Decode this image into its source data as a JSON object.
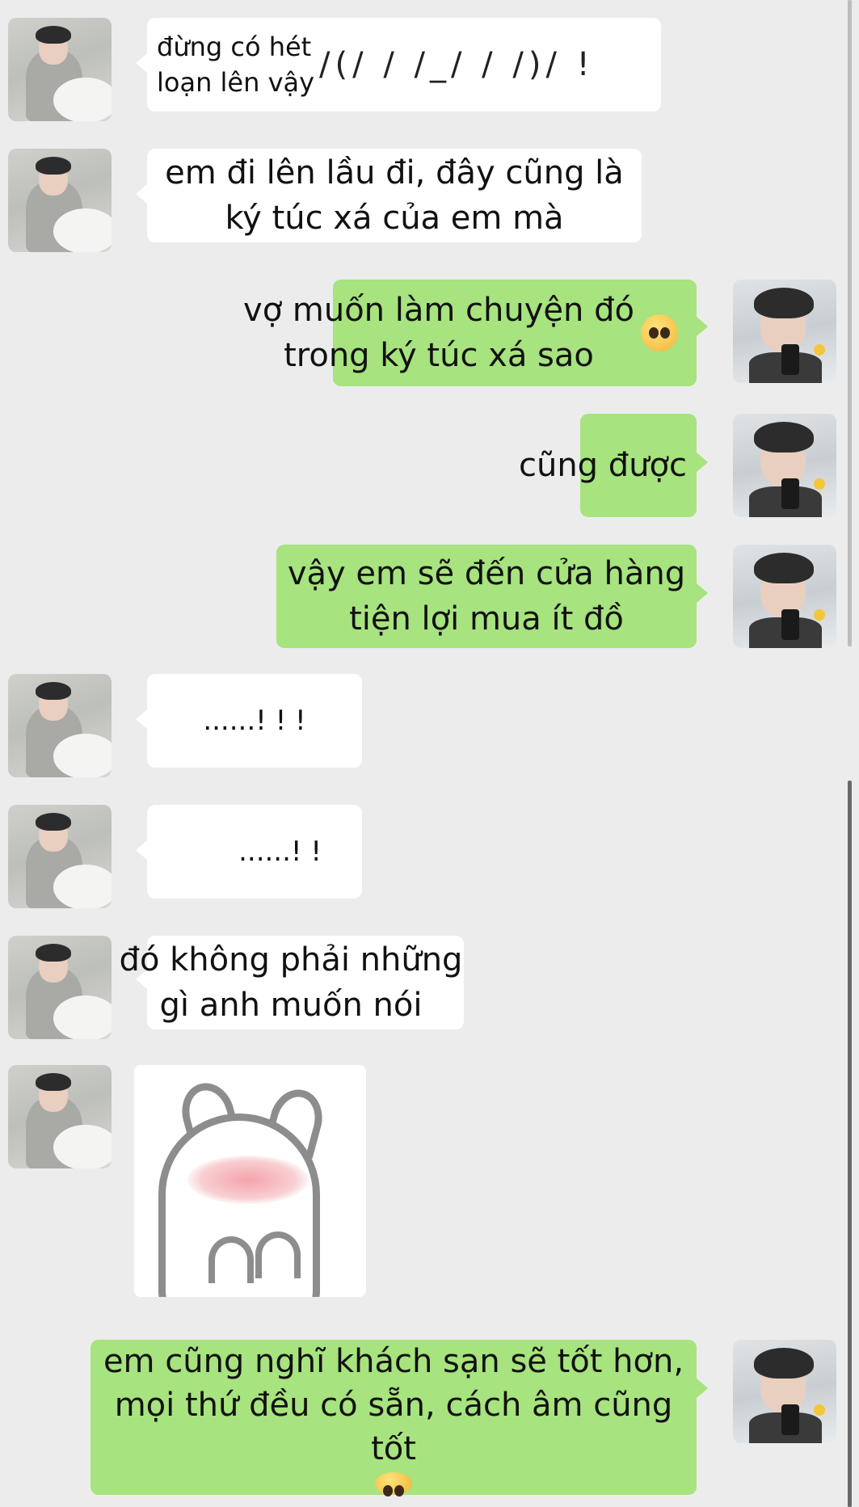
{
  "messages": [
    {
      "sender": "friend",
      "text": "đừng có hét\nloạn lên vậy"
    },
    {
      "sender": "friend",
      "text": "em đi lên lầu đi, đây cũng là\nký túc xá của em mà"
    },
    {
      "sender": "me",
      "text": "vợ muốn làm chuyện đó\ntrong ký túc xá sao"
    },
    {
      "sender": "me",
      "text": "cũng được"
    },
    {
      "sender": "me",
      "text": "vậy em sẽ đến cửa hàng\ntiện lợi mua ít đồ"
    },
    {
      "sender": "friend",
      "text": "......!  !  !"
    },
    {
      "sender": "friend",
      "text": "......!  !"
    },
    {
      "sender": "friend",
      "text": "đó không phải những\ngì anh muốn nói"
    },
    {
      "sender": "friend",
      "type": "sticker",
      "sticker": "blushing-cat-sticker"
    },
    {
      "sender": "me",
      "text": "em cũng nghĩ khách sạn sẽ tốt hơn,\nmọi thứ đều có sẵn, cách âm cũng tốt"
    }
  ],
  "overlay_text": {
    "kaomoji": "/(/ / /_/ / /)/ !"
  },
  "icons": {
    "pleading_emoji": "pleading-face-emoji"
  },
  "colors": {
    "background": "#ececec",
    "friend_bubble": "#ffffff",
    "my_bubble": "#a7e37e"
  }
}
